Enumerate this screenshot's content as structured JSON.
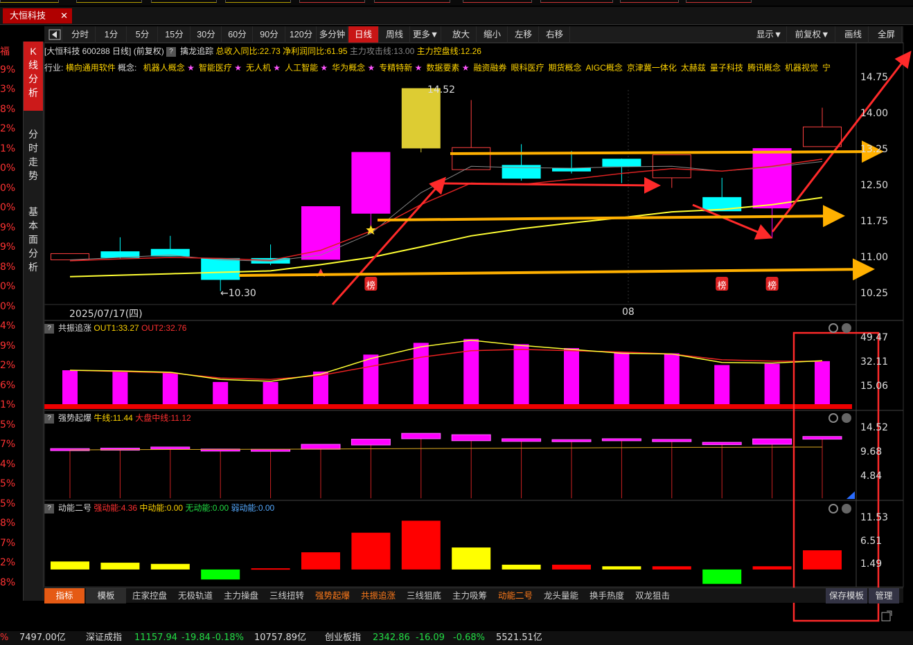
{
  "tab": {
    "title": "大恒科技",
    "close": "✕"
  },
  "left_percents": [
    "福",
    "9%",
    "3%",
    "8%",
    "2%",
    "1%",
    "0%",
    "0%",
    "0%",
    "9%",
    "9%",
    "8%",
    "0%",
    "0%",
    "4%",
    "9%",
    "2%",
    "6%",
    "1%",
    "5%",
    "7%",
    "4%",
    "5%",
    "5%",
    "8%",
    "7%",
    "2%",
    "8%"
  ],
  "side_tabs": [
    {
      "label": "K线分析",
      "active": true
    },
    {
      "label": "分时走势",
      "active": false
    },
    {
      "label": "基本面分析",
      "active": false
    }
  ],
  "toolbar": {
    "left": [
      "分时",
      "1分",
      "5分",
      "15分",
      "30分",
      "60分",
      "90分",
      "120分",
      "多分钟",
      "日线",
      "周线",
      "更多▼",
      "放大",
      "缩小",
      "左移",
      "右移"
    ],
    "active": "日线",
    "right": [
      "显示▼",
      "前复权▼",
      "画线",
      "全屏"
    ]
  },
  "info": {
    "name": "[大恒科技 600288 日线]",
    "fq": "(前复权)",
    "indicator": "擒龙追踪",
    "income": "总收入同比:22.73",
    "profit": "净利润同比:61.95",
    "attack": "主力攻击线:13.00",
    "control": "主力控盘线:12.26"
  },
  "concepts": {
    "industry_label": "行业:",
    "industry": "横向通用软件",
    "concept_label": "概念:",
    "items": [
      {
        "name": "机器人概念",
        "star": true
      },
      {
        "name": "智能医疗",
        "star": true
      },
      {
        "name": "无人机",
        "star": true
      },
      {
        "name": "人工智能",
        "star": true
      },
      {
        "name": "华为概念",
        "star": true
      },
      {
        "name": "专精特新",
        "star": true
      },
      {
        "name": "数据要素",
        "star": true
      },
      {
        "name": "融资融券",
        "star": false
      },
      {
        "name": "眼科医疗",
        "star": false
      },
      {
        "name": "期货概念",
        "star": false
      },
      {
        "name": "AIGC概念",
        "star": false
      },
      {
        "name": "京津冀一体化",
        "star": false
      },
      {
        "name": "太赫兹",
        "star": false
      },
      {
        "name": "量子科技",
        "star": false
      },
      {
        "name": "腾讯概念",
        "star": false
      },
      {
        "name": "机器视觉",
        "star": false
      },
      {
        "name": "宁",
        "star": false
      }
    ]
  },
  "main_axis": [
    "14.75",
    "14.00",
    "13.25",
    "12.50",
    "11.75",
    "11.00",
    "10.25"
  ],
  "annotations": {
    "high": "14.52",
    "low": "10.30",
    "date": "2025/07/17(四)",
    "month": "08",
    "bang": "榜"
  },
  "chart_data": {
    "type": "candlestick",
    "price_range": [
      10.25,
      15.0
    ],
    "candles": [
      {
        "o": 10.95,
        "c": 11.08,
        "h": 11.08,
        "l": 10.95,
        "color": "hollow-red"
      },
      {
        "o": 11.0,
        "c": 11.12,
        "h": 11.42,
        "l": 10.98,
        "color": "cyan"
      },
      {
        "o": 11.03,
        "c": 11.17,
        "h": 11.45,
        "l": 11.03,
        "color": "cyan"
      },
      {
        "o": 10.98,
        "c": 10.54,
        "h": 10.98,
        "l": 10.3,
        "color": "cyan"
      },
      {
        "o": 10.98,
        "c": 10.88,
        "h": 11.27,
        "l": 10.84,
        "color": "cyan"
      },
      {
        "o": 10.96,
        "c": 12.06,
        "h": 12.06,
        "l": 10.96,
        "color": "magenta"
      },
      {
        "o": 11.92,
        "c": 13.19,
        "h": 13.19,
        "l": 11.5,
        "color": "magenta"
      },
      {
        "o": 13.28,
        "c": 14.52,
        "h": 14.52,
        "l": 13.19,
        "color": "yellow"
      },
      {
        "o": 12.83,
        "c": 13.29,
        "h": 14.28,
        "l": 12.83,
        "color": "hollow-red"
      },
      {
        "o": 12.65,
        "c": 12.92,
        "h": 13.36,
        "l": 12.6,
        "color": "cyan"
      },
      {
        "o": 12.8,
        "c": 12.86,
        "h": 13.22,
        "l": 12.75,
        "color": "cyan"
      },
      {
        "o": 12.9,
        "c": 13.05,
        "h": 13.06,
        "l": 12.55,
        "color": "cyan"
      },
      {
        "o": 12.66,
        "c": 13.14,
        "h": 13.14,
        "l": 12.45,
        "color": "hollow-red"
      },
      {
        "o": 11.97,
        "c": 12.25,
        "h": 12.66,
        "l": 11.97,
        "color": "cyan"
      },
      {
        "o": 12.03,
        "c": 13.27,
        "h": 13.27,
        "l": 11.4,
        "color": "magenta"
      },
      {
        "o": 13.31,
        "c": 13.72,
        "h": 14.12,
        "l": 13.31,
        "color": "hollow-red"
      }
    ],
    "ma_red": [
      10.93,
      10.97,
      11.0,
      10.98,
      10.94,
      11.15,
      11.55,
      12.1,
      12.55,
      12.52,
      12.63,
      12.75,
      12.85,
      12.8,
      12.9,
      13.05
    ],
    "ma_gray": [
      10.95,
      11.0,
      11.05,
      10.95,
      10.92,
      11.05,
      11.5,
      12.35,
      12.9,
      12.87,
      12.86,
      12.89,
      12.9,
      12.8,
      12.88,
      13.0
    ],
    "ma_yellow": [
      10.6,
      10.63,
      10.66,
      10.69,
      10.72,
      10.85,
      11.0,
      11.22,
      11.45,
      11.6,
      11.72,
      11.83,
      11.95,
      12.0,
      12.1,
      12.25
    ],
    "markers_bang": [
      6,
      13,
      14
    ],
    "marker_star": 6,
    "marker_rocket": 5
  },
  "sub1": {
    "name": "共振追涨",
    "out1": "OUT1:33.27",
    "out2": "OUT2:32.76",
    "axis": [
      "49.47",
      "32.11",
      "15.06"
    ],
    "range": [
      0,
      52
    ],
    "bars": [
      26,
      25,
      24,
      17,
      17,
      25,
      38,
      47,
      50,
      46,
      43,
      40,
      39,
      30,
      31,
      33
    ],
    "out1_line": [
      26,
      25.5,
      24.5,
      19,
      17.5,
      23,
      35,
      44,
      49,
      45,
      42,
      39,
      38.5,
      32,
      31.5,
      33.3
    ],
    "out2_line": [
      26,
      25,
      24,
      20,
      19,
      22,
      29,
      36,
      41,
      42,
      41,
      40,
      38.5,
      34,
      33,
      32.8
    ]
  },
  "sub2": {
    "name": "强势起爆",
    "bull": "牛线:11.44",
    "market": "大盘中线:11.12",
    "axis": [
      "14.52",
      "9.68",
      "4.84"
    ],
    "range": [
      0,
      17
    ],
    "bars": [
      [
        10.9,
        11.1
      ],
      [
        11.0,
        11.2
      ],
      [
        11.0,
        11.45
      ],
      [
        10.6,
        11.0
      ],
      [
        10.55,
        10.95
      ],
      [
        10.95,
        12.05
      ],
      [
        11.9,
        13.2
      ],
      [
        13.3,
        14.5
      ],
      [
        12.85,
        14.2
      ],
      [
        12.7,
        13.3
      ],
      [
        12.8,
        13.1
      ],
      [
        12.9,
        13.3
      ],
      [
        12.65,
        13.15
      ],
      [
        11.97,
        12.5
      ],
      [
        12.05,
        13.27
      ],
      [
        13.2,
        13.8
      ]
    ],
    "line": [
      10.8,
      10.85,
      10.9,
      10.92,
      10.95,
      11.0,
      11.05,
      11.1,
      11.15,
      11.2,
      11.25,
      11.3,
      11.35,
      11.38,
      11.42,
      11.44
    ]
  },
  "sub3": {
    "name": "动能二号",
    "strong": "强动能:4.36",
    "mid": "中动能:0.00",
    "none": "无动能:0.00",
    "weak": "弱动能:0.00",
    "axis": [
      "11.53",
      "6.51",
      "1.49"
    ],
    "range": [
      -4,
      14
    ],
    "bars": [
      {
        "v": 2,
        "c": "#ffff00"
      },
      {
        "v": 1.7,
        "c": "#ffff00"
      },
      {
        "v": 1.4,
        "c": "#ffff00"
      },
      {
        "v": -2.5,
        "c": "#00ff00"
      },
      {
        "v": 0.3,
        "c": "#ff0000"
      },
      {
        "v": 4.3,
        "c": "#ff0000"
      },
      {
        "v": 9.2,
        "c": "#ff0000"
      },
      {
        "v": 12.2,
        "c": "#ff0000"
      },
      {
        "v": 5.5,
        "c": "#ffff00"
      },
      {
        "v": 1.2,
        "c": "#ffff00"
      },
      {
        "v": 1.2,
        "c": "#ff0000"
      },
      {
        "v": 0.8,
        "c": "#ffff00"
      },
      {
        "v": 0.8,
        "c": "#ff0000"
      },
      {
        "v": -3.6,
        "c": "#00ff00"
      },
      {
        "v": 0.8,
        "c": "#ff0000"
      },
      {
        "v": 4.8,
        "c": "#ff0000"
      }
    ]
  },
  "bottom_tabs": [
    {
      "label": "指标",
      "style": "hl"
    },
    {
      "label": "模板",
      "style": "dark"
    },
    {
      "label": "庄家控盘",
      "style": ""
    },
    {
      "label": "无极轨道",
      "style": ""
    },
    {
      "label": "主力操盘",
      "style": ""
    },
    {
      "label": "三线扭转",
      "style": ""
    },
    {
      "label": "强势起爆",
      "style": "orange"
    },
    {
      "label": "共振追涨",
      "style": "orange"
    },
    {
      "label": "三线狙底",
      "style": ""
    },
    {
      "label": "主力吸筹",
      "style": ""
    },
    {
      "label": "动能二号",
      "style": "orange"
    },
    {
      "label": "龙头量能",
      "style": ""
    },
    {
      "label": "换手热度",
      "style": ""
    },
    {
      "label": "双龙狙击",
      "style": ""
    },
    {
      "label": "保存模板",
      "style": "save"
    },
    {
      "label": "管理",
      "style": "save"
    }
  ],
  "ticker": {
    "a": "%",
    "b": "7497.00亿",
    "c": "深证成指",
    "d": "11157.94",
    "e": "-19.84",
    "f": "-0.18%",
    "g": "10757.89亿",
    "h": "创业板指",
    "i": "2342.86",
    "j": "-16.09",
    "k": "-0.68%",
    "l": "5521.51亿"
  },
  "colors": {
    "up": "#ff00ff",
    "down": "#00ffff",
    "ma_yellow": "#ffff33",
    "ma_red": "#dd2222",
    "accent": "#cc1a1a"
  }
}
